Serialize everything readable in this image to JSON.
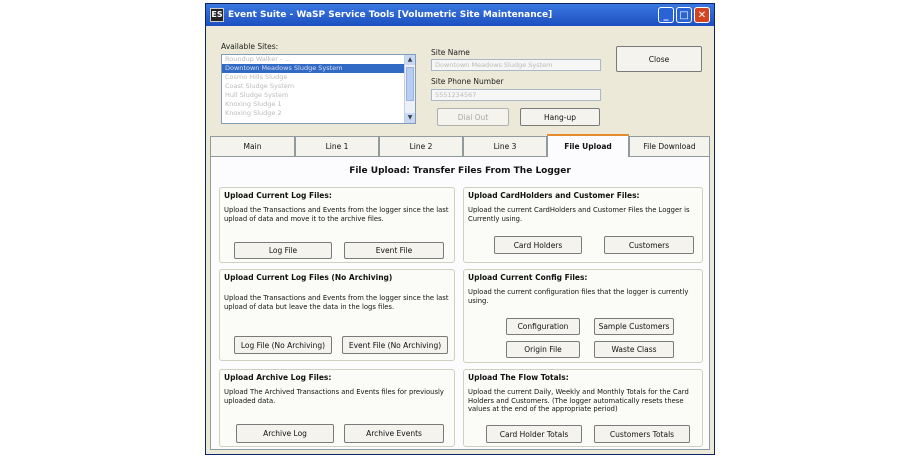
{
  "window": {
    "title": "Event Suite - WaSP Service Tools [Volumetric Site Maintenance]",
    "app_icon": "ES"
  },
  "sites": {
    "label": "Available Sites:",
    "items": [
      "Roundup Walker - ...",
      "Downtown Meadows Sludge System",
      "Cosmo Hills Sludge",
      "Coast Sludge System",
      "Hull Sludge System",
      "Knoxing Sludge 1",
      "Knoxing Sludge 2"
    ],
    "selected_index": 1
  },
  "site_name": {
    "label": "Site Name",
    "value": "Downtown Meadows Sludge System"
  },
  "site_phone": {
    "label": "Site Phone Number",
    "value": "5551234567"
  },
  "buttons": {
    "close": "Close",
    "dial_out": "Dial Out",
    "hang_up": "Hang-up"
  },
  "tabs": [
    "Main",
    "Line 1",
    "Line 2",
    "Line 3",
    "File Upload",
    "File Download"
  ],
  "active_tab": 4,
  "panel_title": "File Upload: Transfer Files From The Logger",
  "groups": {
    "current_log": {
      "title": "Upload Current Log Files:",
      "desc": "Upload the Transactions and Events from the logger since the last upload of data and move it to the archive files.",
      "btn1": "Log File",
      "btn2": "Event File"
    },
    "current_log_no_arch": {
      "title": "Upload Current Log Files (No Archiving)",
      "desc": "Upload the Transactions and Events from the logger since the last upload of data but leave the data in the logs files.",
      "btn1": "Log File (No Archiving)",
      "btn2": "Event File (No Archiving)"
    },
    "archive_log": {
      "title": "Upload Archive Log Files:",
      "desc": "Upload The Archived Transactions and Events files for previously uploaded data.",
      "btn1": "Archive Log",
      "btn2": "Archive Events"
    },
    "cardholders": {
      "title": "Upload CardHolders and Customer Files:",
      "desc": "Upload the current CardHolders and Customer Files the Logger is Currently using.",
      "btn1": "Card Holders",
      "btn2": "Customers"
    },
    "config": {
      "title": "Upload Current Config Files:",
      "desc": "Upload the current configuration files that the logger is currently using.",
      "btn1": "Configuration",
      "btn2": "Sample Customers",
      "btn3": "Origin File",
      "btn4": "Waste Class"
    },
    "flow_totals": {
      "title": "Upload The Flow Totals:",
      "desc": "Upload the current Daily, Weekly and Monthly Totals for the Card Holders and Customers. (The logger automatically resets these values at the end of the appropriate period)",
      "btn1": "Card Holder Totals",
      "btn2": "Customers Totals"
    }
  }
}
